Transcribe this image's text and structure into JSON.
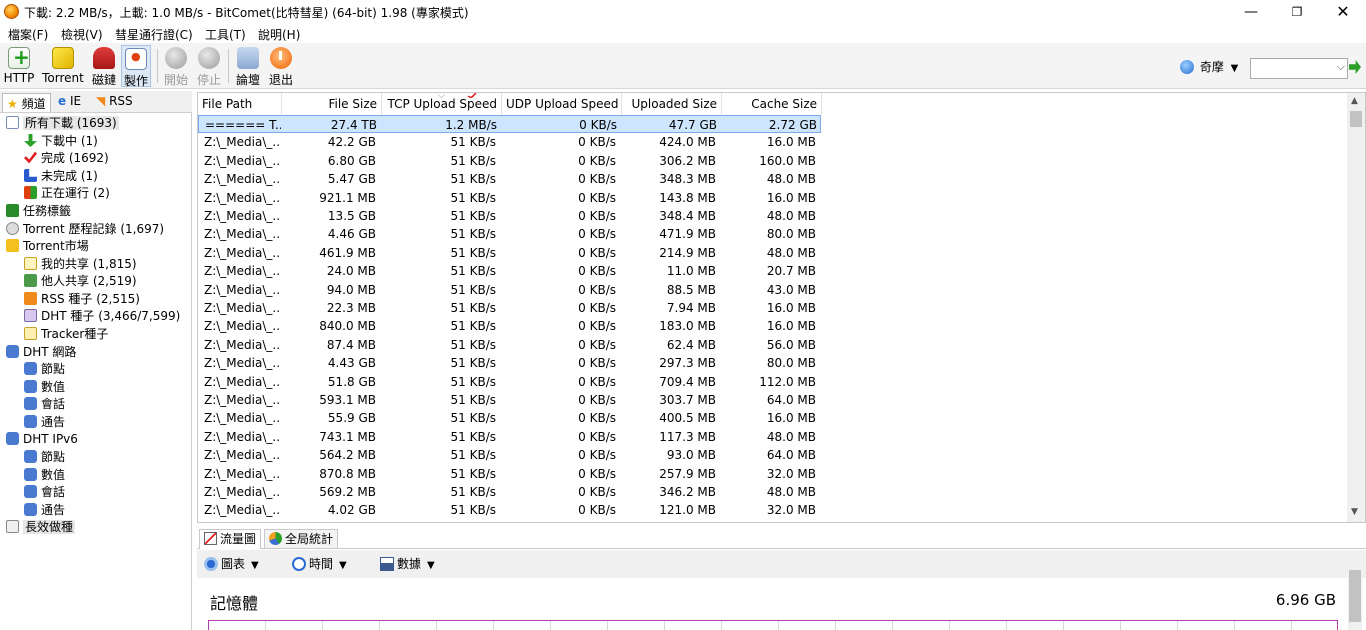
{
  "title": "下載: 2.2 MB/s，上載: 1.0 MB/s - BitComet(比特彗星) (64-bit) 1.98 (專家模式)",
  "window_controls": {
    "minimize": "—",
    "maximize": "❐",
    "close": "✕"
  },
  "menu": [
    "檔案(F)",
    "檢視(V)",
    "彗星通行證(C)",
    "工具(T)",
    "說明(H)"
  ],
  "toolbar": {
    "http": "HTTP",
    "torrent": "Torrent",
    "magnet": "磁鏈",
    "make": "製作",
    "start": "開始",
    "stop": "停止",
    "forum": "論壇",
    "exit": "退出"
  },
  "language": {
    "label": "奇摩",
    "dropdown": "▼"
  },
  "search": {
    "value": "",
    "dropdown": "⌵"
  },
  "left_tabs": [
    "頻道",
    "IE",
    "RSS"
  ],
  "tree": [
    {
      "label": "所有下載 (1693)"
    },
    {
      "label": "下載中 (1)"
    },
    {
      "label": "完成 (1692)"
    },
    {
      "label": "未完成 (1)"
    },
    {
      "label": "正在運行 (2)"
    },
    {
      "label": "任務標籤"
    },
    {
      "label": "Torrent 歷程記錄 (1,697)"
    },
    {
      "label": "Torrent市場"
    },
    {
      "label": "我的共享 (1,815)"
    },
    {
      "label": "他人共享 (2,519)"
    },
    {
      "label": "RSS 種子 (2,515)"
    },
    {
      "label": "DHT 種子 (3,466/7,599)"
    },
    {
      "label": "Tracker種子"
    },
    {
      "label": "DHT 網路"
    },
    {
      "label": "節點"
    },
    {
      "label": "數值"
    },
    {
      "label": "會話"
    },
    {
      "label": "通告"
    },
    {
      "label": "DHT IPv6"
    },
    {
      "label": "節點"
    },
    {
      "label": "數值"
    },
    {
      "label": "會話"
    },
    {
      "label": "通告"
    },
    {
      "label": "長效做種"
    }
  ],
  "table": {
    "columns": [
      "File Path",
      "File Size",
      "TCP Upload Speed",
      "UDP Upload Speed",
      "Uploaded Size",
      "Cache Size"
    ],
    "rows": [
      [
        "====== T...",
        "27.4 TB",
        "1.2 MB/s",
        "0 KB/s",
        "47.7 GB",
        "2.72 GB"
      ],
      [
        "Z:\\_Media\\_...",
        "42.2 GB",
        "51 KB/s",
        "0 KB/s",
        "424.0 MB",
        "16.0 MB"
      ],
      [
        "Z:\\_Media\\_...",
        "6.80 GB",
        "51 KB/s",
        "0 KB/s",
        "306.2 MB",
        "160.0 MB"
      ],
      [
        "Z:\\_Media\\_...",
        "5.47 GB",
        "51 KB/s",
        "0 KB/s",
        "348.3 MB",
        "48.0 MB"
      ],
      [
        "Z:\\_Media\\_...",
        "921.1 MB",
        "51 KB/s",
        "0 KB/s",
        "143.8 MB",
        "16.0 MB"
      ],
      [
        "Z:\\_Media\\_...",
        "13.5 GB",
        "51 KB/s",
        "0 KB/s",
        "348.4 MB",
        "48.0 MB"
      ],
      [
        "Z:\\_Media\\_...",
        "4.46 GB",
        "51 KB/s",
        "0 KB/s",
        "471.9 MB",
        "80.0 MB"
      ],
      [
        "Z:\\_Media\\_...",
        "461.9 MB",
        "51 KB/s",
        "0 KB/s",
        "214.9 MB",
        "48.0 MB"
      ],
      [
        "Z:\\_Media\\_...",
        "24.0 MB",
        "51 KB/s",
        "0 KB/s",
        "11.0 MB",
        "20.7 MB"
      ],
      [
        "Z:\\_Media\\_...",
        "94.0 MB",
        "51 KB/s",
        "0 KB/s",
        "88.5 MB",
        "43.0 MB"
      ],
      [
        "Z:\\_Media\\_...",
        "22.3 MB",
        "51 KB/s",
        "0 KB/s",
        "7.94 MB",
        "16.0 MB"
      ],
      [
        "Z:\\_Media\\_...",
        "840.0 MB",
        "51 KB/s",
        "0 KB/s",
        "183.0 MB",
        "16.0 MB"
      ],
      [
        "Z:\\_Media\\_...",
        "87.4 MB",
        "51 KB/s",
        "0 KB/s",
        "62.4 MB",
        "56.0 MB"
      ],
      [
        "Z:\\_Media\\_...",
        "4.43 GB",
        "51 KB/s",
        "0 KB/s",
        "297.3 MB",
        "80.0 MB"
      ],
      [
        "Z:\\_Media\\_...",
        "51.8 GB",
        "51 KB/s",
        "0 KB/s",
        "709.4 MB",
        "112.0 MB"
      ],
      [
        "Z:\\_Media\\_...",
        "593.1 MB",
        "51 KB/s",
        "0 KB/s",
        "303.7 MB",
        "64.0 MB"
      ],
      [
        "Z:\\_Media\\_...",
        "55.9 GB",
        "51 KB/s",
        "0 KB/s",
        "400.5 MB",
        "16.0 MB"
      ],
      [
        "Z:\\_Media\\_...",
        "743.1 MB",
        "51 KB/s",
        "0 KB/s",
        "117.3 MB",
        "48.0 MB"
      ],
      [
        "Z:\\_Media\\_...",
        "564.2 MB",
        "51 KB/s",
        "0 KB/s",
        "93.0 MB",
        "64.0 MB"
      ],
      [
        "Z:\\_Media\\_...",
        "870.8 MB",
        "51 KB/s",
        "0 KB/s",
        "257.9 MB",
        "32.0 MB"
      ],
      [
        "Z:\\_Media\\_...",
        "569.2 MB",
        "51 KB/s",
        "0 KB/s",
        "346.2 MB",
        "48.0 MB"
      ],
      [
        "Z:\\_Media\\_...",
        "4.02 GB",
        "51 KB/s",
        "0 KB/s",
        "121.0 MB",
        "32.0 MB"
      ]
    ]
  },
  "bottom_tabs": [
    "流量圖",
    "全局統計"
  ],
  "controls": {
    "chart": "圖表",
    "time": "時間",
    "data": "數據",
    "dropdown": "▼"
  },
  "memory": {
    "label": "記憶體",
    "value": "6.96 GB"
  },
  "colors": {
    "selected_row": "#cde5ff",
    "memory_graph_border": "#b040b0"
  }
}
